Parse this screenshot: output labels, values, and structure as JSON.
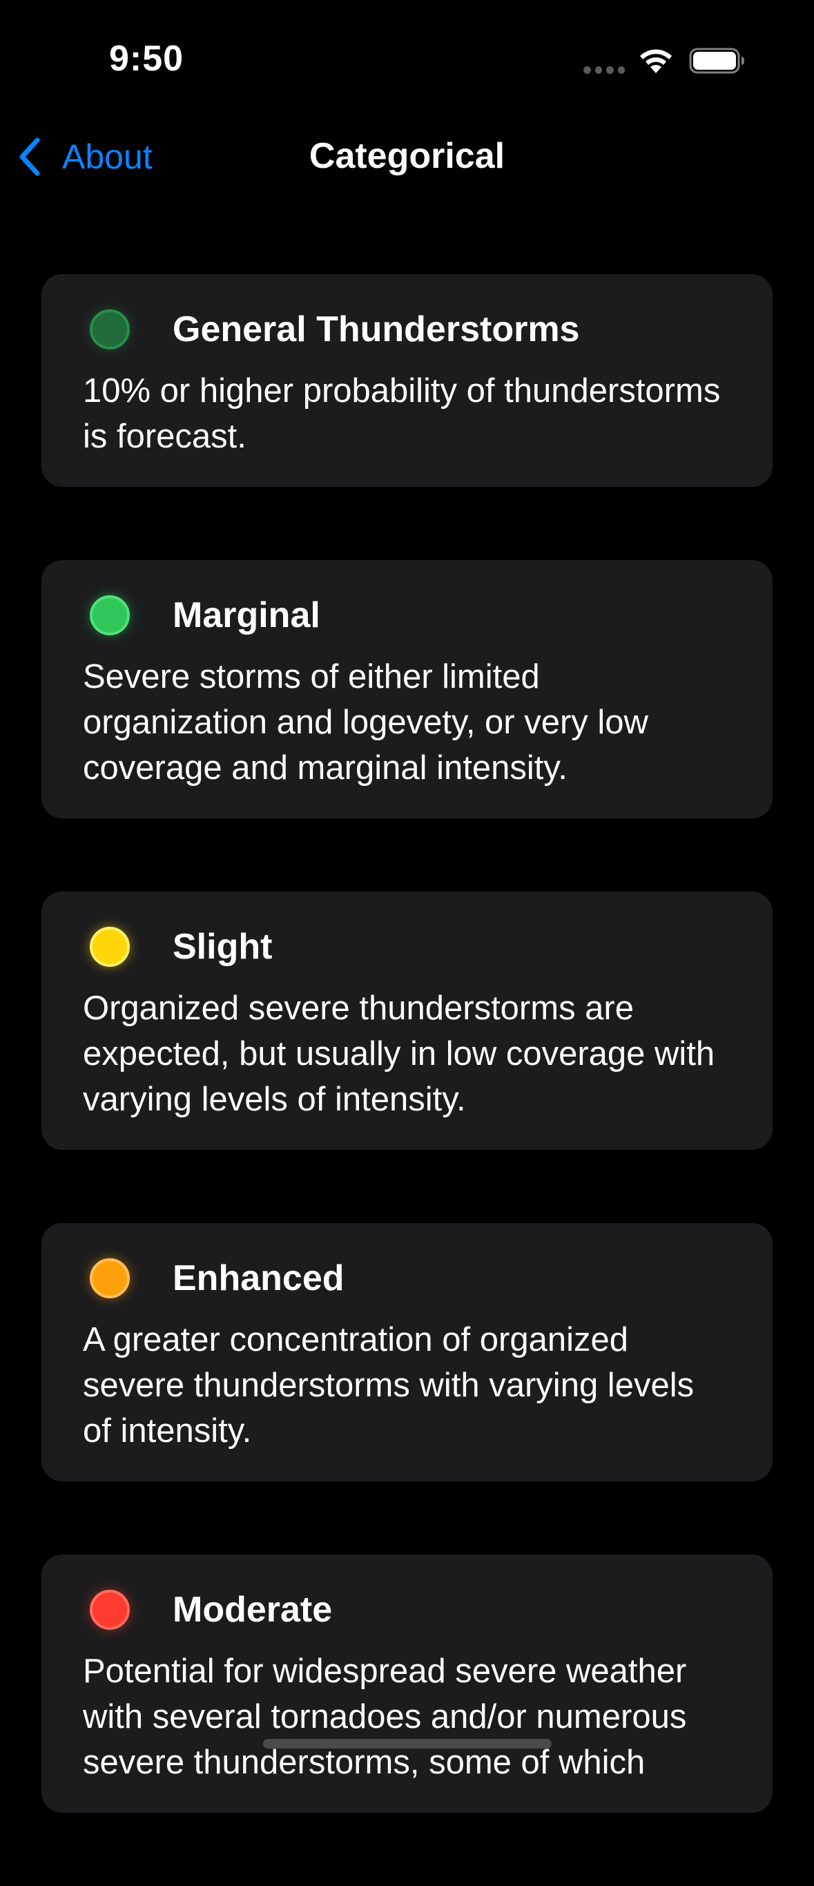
{
  "status_bar": {
    "time": "9:50"
  },
  "nav": {
    "back_label": "About",
    "title": "Categorical",
    "accent_color": "#0a84ff"
  },
  "categories": [
    {
      "name": "General Thunderstorms",
      "description": "10% or higher probability of thunderstorms is forecast.",
      "color": "#1f6b3a",
      "border_color": "#2a8c4c"
    },
    {
      "name": "Marginal",
      "description": "Severe storms of either limited organization and logevety, or very low coverage and marginal intensity.",
      "color": "#2fc75a",
      "border_color": "#53e07a"
    },
    {
      "name": "Slight",
      "description": "Organized severe thunderstorms are expected, but usually in low coverage with varying levels of intensity.",
      "color": "#ffd60a",
      "border_color": "#fff06b"
    },
    {
      "name": "Enhanced",
      "description": "A greater concentration of organized severe thunderstorms with varying levels of intensity.",
      "color": "#ff9f0a",
      "border_color": "#ffbf5a"
    },
    {
      "name": "Moderate",
      "description": "Potential for widespread severe weather with several tornadoes and/or numerous severe thunderstorms, some of which",
      "color": "#ff3b30",
      "border_color": "#ff6a61"
    }
  ]
}
